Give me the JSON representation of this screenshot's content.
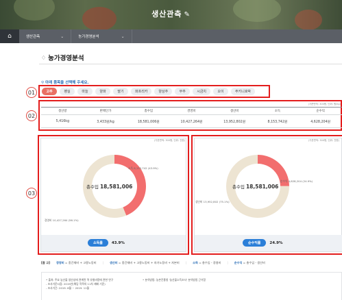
{
  "hero": {
    "title": "생산관측",
    "pen_icon": "pen-icon"
  },
  "navbar": {
    "home_icon": "home-icon",
    "crumbs": [
      {
        "label": "생산관측"
      },
      {
        "label": "농가경영분석"
      }
    ]
  },
  "page": {
    "title": "농가경영분석"
  },
  "prompt": "아래 품목을 선택해 주세요.",
  "markers": {
    "m1": "01",
    "m2": "02",
    "m3": "03"
  },
  "crops": [
    "고추",
    "팽실",
    "마늘",
    "양파",
    "딸기",
    "파프리카",
    "양상추",
    "부추",
    "시금치",
    "오이",
    "주키니호박"
  ],
  "selected_crop": "고추",
  "stats": {
    "unit_note": "(기준면적: 300평, 단위: 원/kg)",
    "headers": [
      "생산량",
      "판매단가",
      "총수입",
      "경영비",
      "생산비",
      "소득",
      "순수익"
    ],
    "values": [
      "5,416kg",
      "3,433원/kg",
      "18,581,006원",
      "10,427,264원",
      "13,952,802원",
      "8,153,742원",
      "4,628,204원"
    ]
  },
  "left_panel": {
    "note": "(기준면적: 300평, 단위: 천원)",
    "center_label": "총수입",
    "center_value": "18,581,006",
    "seg_top_label": "소득 8,153,742 (43.9%)",
    "seg_left_label": "경영비 10,427,264 (56.1%)",
    "ratio_label": "소득률",
    "ratio_value": "43.9%",
    "chart_data": {
      "type": "pie",
      "title": "",
      "labels": [
        "소득",
        "경영비"
      ],
      "values": [
        8153742,
        10427264
      ],
      "percents": [
        43.9,
        56.1
      ],
      "colors": [
        "#f26e6e",
        "#ede4d2"
      ]
    }
  },
  "right_panel": {
    "note": "(기준면적: 300평, 단위: 천원)",
    "center_label": "총수입",
    "center_value": "18,581,006",
    "seg_top_label": "순수익 4,628,204 (24.9%)",
    "seg_left_label": "생산비 13,952,802 (75.1%)",
    "ratio_label": "순수익률",
    "ratio_value": "24.9%",
    "chart_data": {
      "type": "pie",
      "title": "",
      "labels": [
        "순수익",
        "생산비"
      ],
      "values": [
        4628204,
        13952802
      ],
      "percents": [
        24.9,
        75.1
      ],
      "colors": [
        "#f26e6e",
        "#ede4d2"
      ]
    }
  },
  "formula": {
    "ref": "[참 고]",
    "items": [
      {
        "hl": "경영비",
        "text": " = 중간재비 + 고용노동비"
      },
      {
        "hl": "생산비",
        "text": " = 중간재비 + 고용노동비 + 자가노동비 + 자본비"
      },
      {
        "hl": "소득",
        "text": " = 총수입 - 경영비"
      },
      {
        "hl": "순수익",
        "text": " = 총수입 - 생산비"
      }
    ]
  },
  "notes": {
    "l1": "• 출처: 주요 농산물 생산성에 관계된 역 유통비용에 관한 연구",
    "l2": "  - 조사기준시점: 2019년(해당 작목의 11차 재배 기준)",
    "l3": "  - 조사기간: 2019. 6월 ~ 2019. 11월",
    "r1": "• 분석방법: 농촌진흥청 '농산물소득조사' 분석방법 근거함"
  },
  "colors": {
    "accent": "#e97064",
    "highlight": "#2c6fb7",
    "income": "#f26e6e",
    "cost": "#ede4d2",
    "frame": "#e31c1c"
  }
}
